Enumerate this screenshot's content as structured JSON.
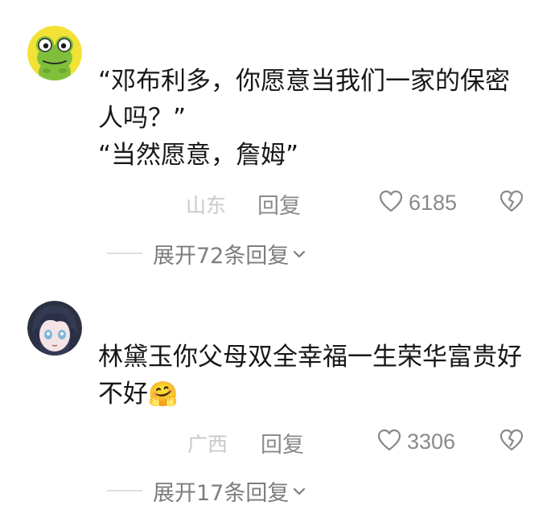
{
  "comments": [
    {
      "text": "“邓布利多，你愿意当我们一家的保密人吗？”\n“当然愿意，詹姆”",
      "location": "山东",
      "reply_label": "回复",
      "likes": "6185",
      "expand_label": "展开72条回复"
    },
    {
      "text": "林黛玉你父母双全幸福一生荣华富贵好不好",
      "emoji": "🤗",
      "location": "广西",
      "reply_label": "回复",
      "likes": "3306",
      "expand_label": "展开17条回复"
    }
  ],
  "colors": {
    "text": "#171717",
    "meta": "#8a8a8a",
    "location": "#c9c9c9",
    "frog_bg": "#f2e236",
    "frog_green": "#7fbf3b"
  },
  "icons": [
    "frog-avatar",
    "anime-girl-avatar",
    "heart-icon",
    "broken-heart-icon",
    "chevron-down-icon",
    "hugging-face-emoji"
  ]
}
